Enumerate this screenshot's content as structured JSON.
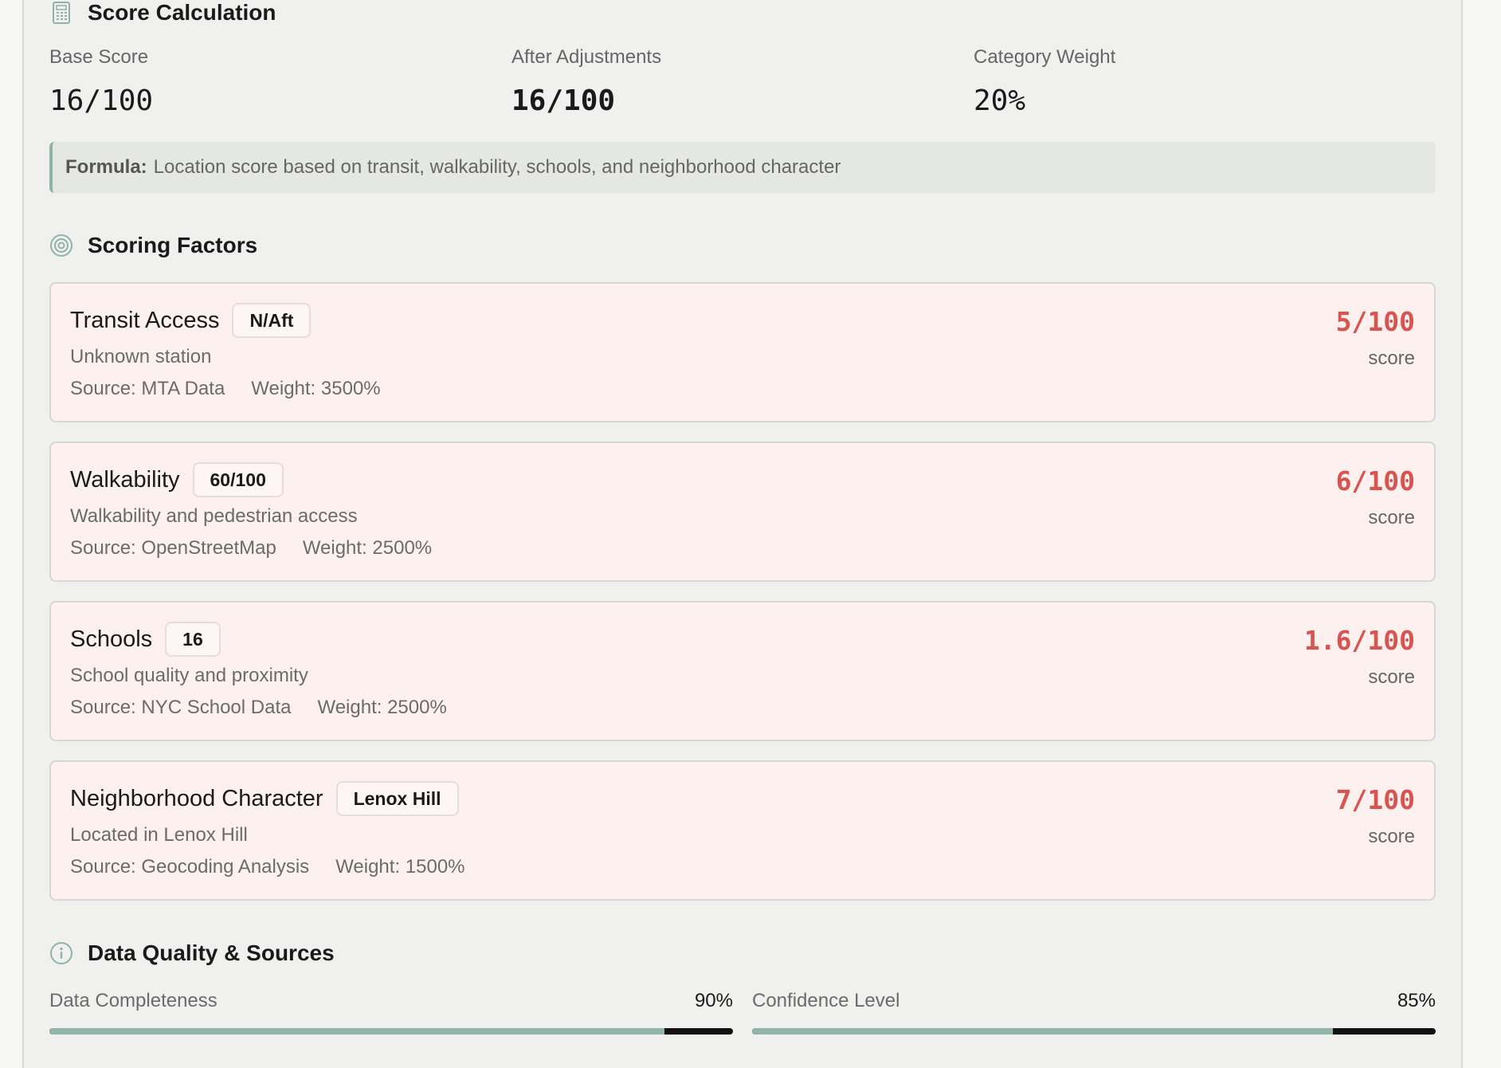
{
  "score_calculation": {
    "title": "Score Calculation",
    "icon": "calculator-icon",
    "base_score": {
      "label": "Base Score",
      "value": "16/100"
    },
    "after_adjustments": {
      "label": "After Adjustments",
      "value": "16/100"
    },
    "category_weight": {
      "label": "Category Weight",
      "value": "20%"
    },
    "formula": {
      "label": "Formula:",
      "text": "Location score based on transit, walkability, schools, and neighborhood character"
    }
  },
  "scoring_factors": {
    "title": "Scoring Factors",
    "icon": "target-icon",
    "items": [
      {
        "name": "Transit Access",
        "badge": "N/Aft",
        "description": "Unknown station",
        "source": "Source: MTA Data",
        "weight": "Weight: 3500%",
        "score": "5/100",
        "score_label": "score"
      },
      {
        "name": "Walkability",
        "badge": "60/100",
        "description": "Walkability and pedestrian access",
        "source": "Source: OpenStreetMap",
        "weight": "Weight: 2500%",
        "score": "6/100",
        "score_label": "score"
      },
      {
        "name": "Schools",
        "badge": "16",
        "description": "School quality and proximity",
        "source": "Source: NYC School Data",
        "weight": "Weight: 2500%",
        "score": "1.6/100",
        "score_label": "score"
      },
      {
        "name": "Neighborhood Character",
        "badge": "Lenox Hill",
        "description": "Located in Lenox Hill",
        "source": "Source: Geocoding Analysis",
        "weight": "Weight: 1500%",
        "score": "7/100",
        "score_label": "score"
      }
    ]
  },
  "data_quality": {
    "title": "Data Quality & Sources",
    "icon": "info-icon",
    "completeness": {
      "label": "Data Completeness",
      "value": "90%",
      "fraction": 0.9
    },
    "confidence": {
      "label": "Confidence Level",
      "value": "85%",
      "fraction": 0.85
    }
  },
  "colors": {
    "accent": "#93b4aa",
    "score_red": "#d9534f",
    "factor_bg": "#fdf1f0"
  }
}
